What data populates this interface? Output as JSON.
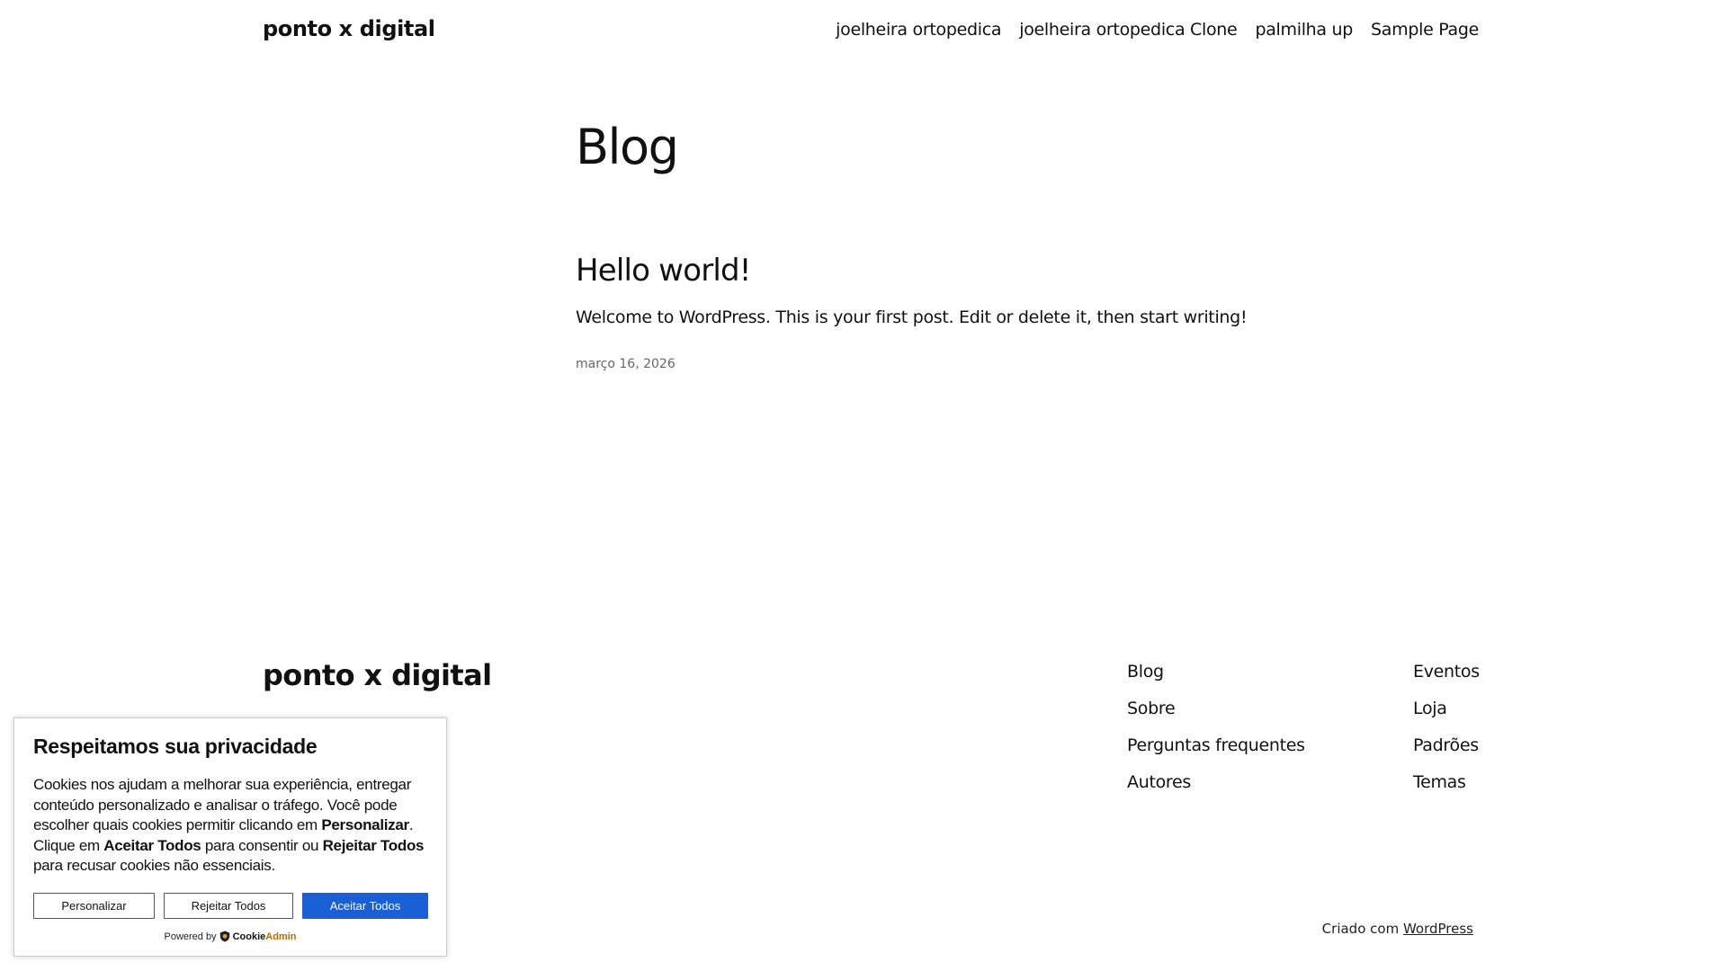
{
  "header": {
    "site_title": "ponto x digital",
    "nav": [
      {
        "label": "joelheira ortopedica"
      },
      {
        "label": "joelheira ortopedica Clone"
      },
      {
        "label": "palmilha up"
      },
      {
        "label": "Sample Page"
      }
    ]
  },
  "main": {
    "page_title": "Blog",
    "post": {
      "title": "Hello world!",
      "excerpt": "Welcome to WordPress. This is your first post. Edit or delete it, then start writing!",
      "date": "março 16, 2026"
    }
  },
  "footer": {
    "site_title": "ponto x digital",
    "col1": [
      {
        "label": "Blog"
      },
      {
        "label": "Sobre"
      },
      {
        "label": "Perguntas frequentes"
      },
      {
        "label": "Autores"
      }
    ],
    "col2": [
      {
        "label": "Eventos"
      },
      {
        "label": "Loja"
      },
      {
        "label": "Padrões"
      },
      {
        "label": "Temas"
      }
    ],
    "credit_prefix": "Criado com ",
    "credit_link": "WordPress"
  },
  "cookie_banner": {
    "title": "Respeitamos sua privacidade",
    "text": {
      "p1": "Cookies nos ajudam a melhorar sua experiência, entregar conteúdo personalizado e analisar o tráfego. Você pode escolher quais cookies permitir clicando em ",
      "b1": "Personalizar",
      "p2": ". Clique em ",
      "b2": "Aceitar Todos",
      "p3": " para consentir ou ",
      "b3": "Rejeitar Todos",
      "p4": " para recusar cookies não essenciais."
    },
    "buttons": {
      "customize": "Personalizar",
      "reject": "Rejeitar Todos",
      "accept": "Aceitar Todos"
    },
    "powered_by": "Powered by",
    "brand_a": "Cookie",
    "brand_b": "Admin",
    "accent_color": "#1a5fd6"
  }
}
